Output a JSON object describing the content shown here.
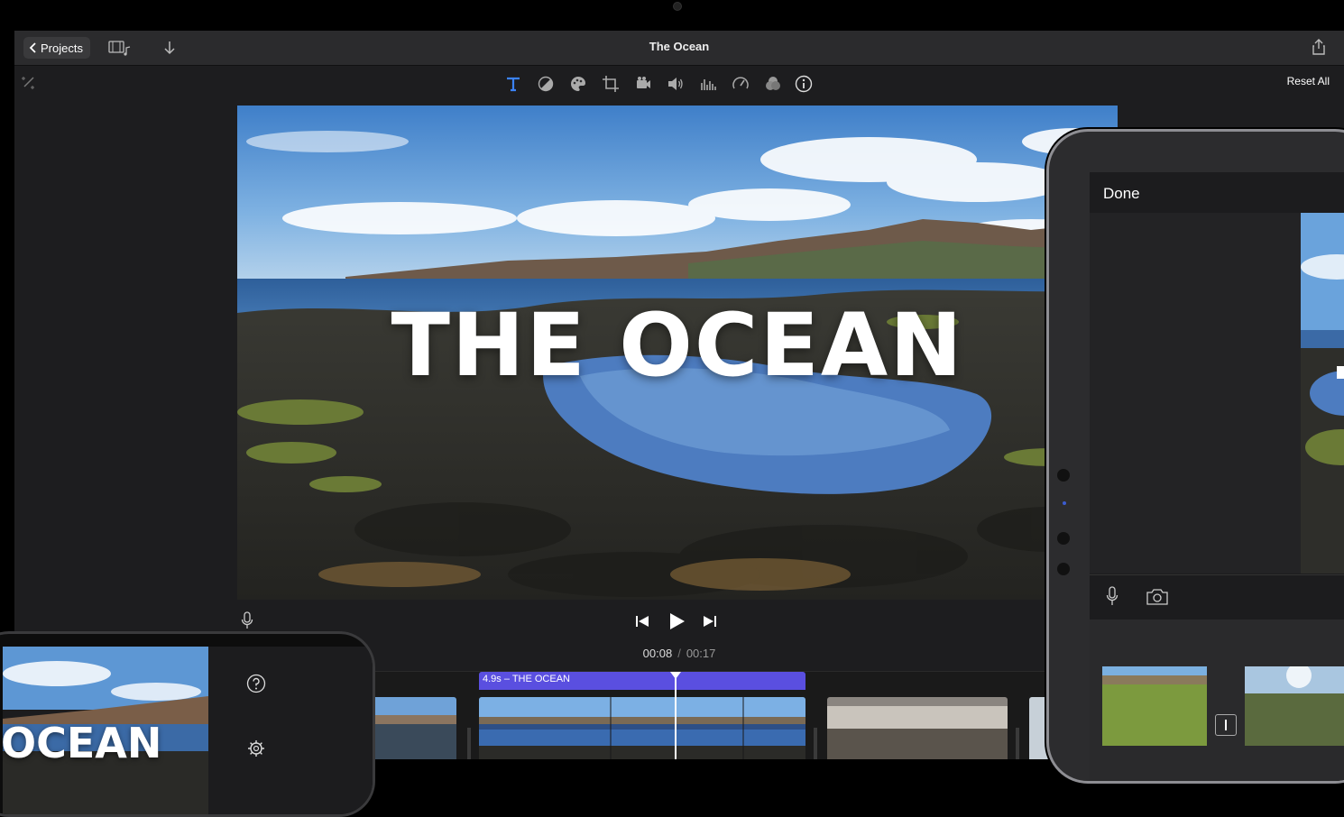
{
  "app": {
    "window_title": "The Ocean",
    "back_label": "Projects",
    "reset_all_label": "Reset All"
  },
  "toolbar": {
    "tools": [
      "title-tool",
      "color-balance",
      "color-correction",
      "crop",
      "stabilization",
      "volume",
      "noise-reduction",
      "speed",
      "clip-filter",
      "clip-info"
    ],
    "accent": "#3b82f6"
  },
  "viewer": {
    "overlay_title": "THE OCEAN"
  },
  "playback": {
    "current_time": "00:08",
    "separator": "/",
    "total_time": "00:17"
  },
  "timeline": {
    "selected_clip_label": "4.9s – THE OCEAN",
    "selected_clip_color": "#5a4fe0"
  },
  "ipad": {
    "done_label": "Done"
  },
  "iphone": {
    "overlay_title": "OCEAN"
  }
}
